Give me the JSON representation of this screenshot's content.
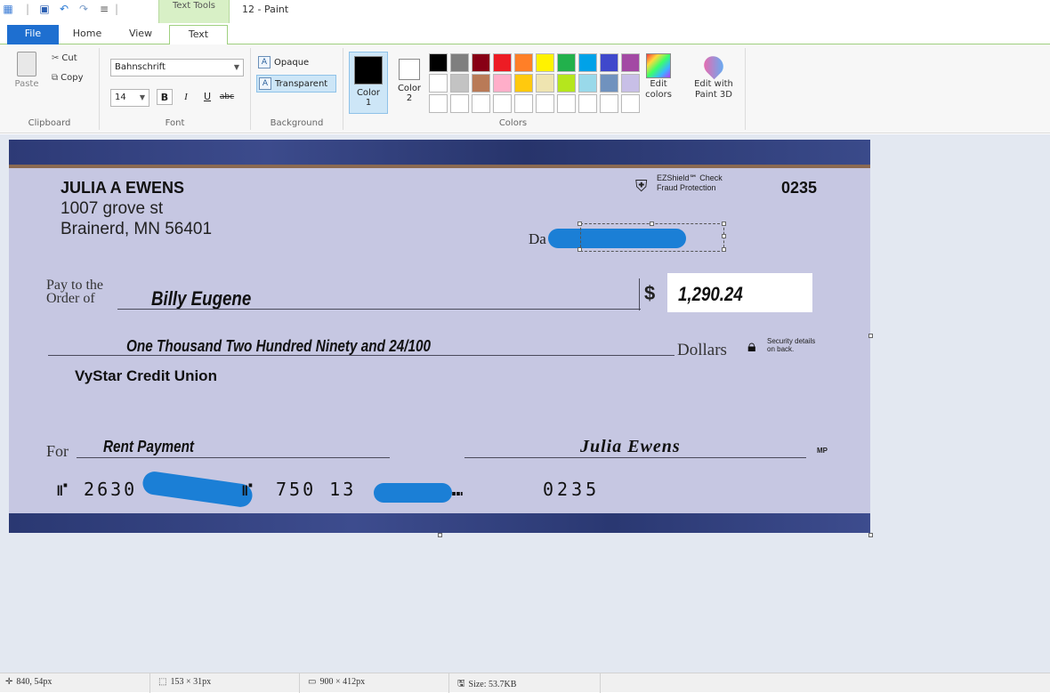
{
  "app": {
    "window_title": "12 - Paint",
    "contextual_tab": "Text Tools"
  },
  "tabs": [
    {
      "label": "File"
    },
    {
      "label": "Home"
    },
    {
      "label": "View"
    },
    {
      "label": "Text"
    }
  ],
  "ribbon": {
    "clipboard": {
      "paste": "Paste",
      "cut": "Cut",
      "copy": "Copy",
      "label": "Clipboard"
    },
    "font": {
      "family": "Bahnschrift",
      "size": "14",
      "bold": "B",
      "italic": "I",
      "underline": "U",
      "strike": "abc",
      "label": "Font"
    },
    "background": {
      "opaque": "Opaque",
      "transparent": "Transparent",
      "label": "Background"
    },
    "colors": {
      "color1": "Color 1",
      "color1_line1": "Color",
      "color1_line2": "1",
      "color2_line1": "Color",
      "color2_line2": "2",
      "color1_value": "#000000",
      "color2_value": "#ffffff",
      "edit_colors_line1": "Edit",
      "edit_colors_line2": "colors",
      "paint3d_line1": "Edit with",
      "paint3d_line2": "Paint 3D",
      "label": "Colors",
      "palette": [
        "#000000",
        "#7f7f7f",
        "#880015",
        "#ed1c24",
        "#ff7f27",
        "#fff200",
        "#22b14c",
        "#00a2e8",
        "#3f48cc",
        "#a349a4",
        "#ffffff",
        "#c3c3c3",
        "#b97a57",
        "#ffaec9",
        "#ffc90e",
        "#efe4b0",
        "#b5e61d",
        "#99d9ea",
        "#7092be",
        "#c8bfe7",
        "#ffffff",
        "#ffffff",
        "#ffffff",
        "#ffffff",
        "#ffffff",
        "#ffffff",
        "#ffffff",
        "#ffffff",
        "#ffffff",
        "#ffffff"
      ]
    }
  },
  "check": {
    "name": "JULIA A EWENS",
    "address1": "1007 grove st",
    "address2": "Brainerd, MN 56401",
    "fraud_line1": "EZShield℠ Check",
    "fraud_line2": "Fraud Protection",
    "check_number": "0235",
    "date_label": "Da",
    "pay_to_line1": "Pay to the",
    "pay_to_line2": "Order of",
    "payee": "Billy Eugene",
    "dollar_sign": "$",
    "amount": "1,290.24",
    "amount_words": "One Thousand Two Hundred Ninety and 24/100",
    "dollars_label": "Dollars",
    "security_line1": "Security details",
    "security_line2": "on back.",
    "bank": "VyStar Credit Union",
    "for_label": "For",
    "memo": "Rent Payment",
    "signature": "Julia Ewens",
    "mp": "MP",
    "micr_routing_prefix": "⑈ 2630",
    "micr_suffix1": "⑈",
    "micr_account_prefix": "750 13",
    "micr_suffix2": "⑉",
    "micr_check": "0235"
  },
  "status": {
    "cursor": "840, 54px",
    "selection": "153 × 31px",
    "image_size": "900 × 412px",
    "file_size": "Size: 53.7KB"
  }
}
